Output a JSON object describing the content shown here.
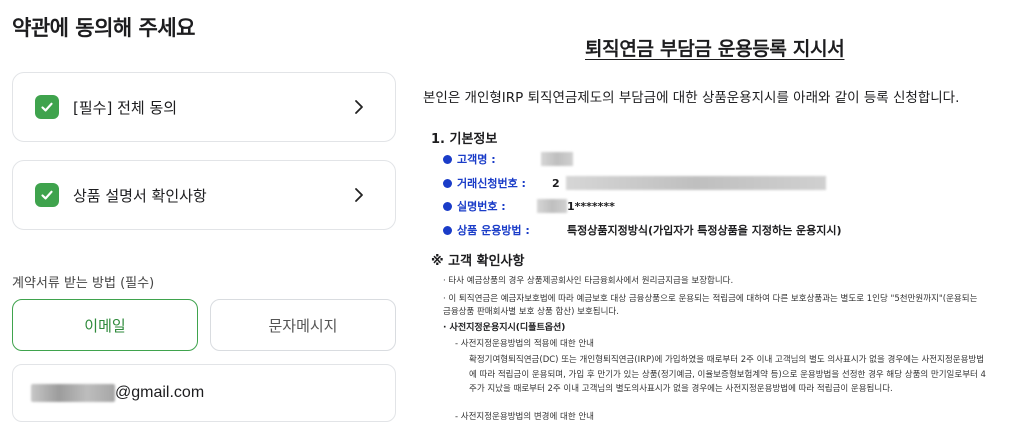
{
  "left": {
    "title": "약관에 동의해 주세요",
    "agree_all": "[필수] 전체 동의",
    "product_confirm": "상품 설명서 확인사항",
    "receive_label": "계약서류 받는 방법 (필수)",
    "email_button": "이메일",
    "sms_button": "문자메시지",
    "email_suffix": "@gmail.com",
    "accent_color": "#3fa34d"
  },
  "doc": {
    "title": "퇴직연금 부담금 운용등록 지시서",
    "intro": "본인은 개인형IRP 퇴직연금제도의 부담금에 대한 상품운용지시를 아래와 같이 등록 신청합니다.",
    "section1": "1. 기본정보",
    "fields": {
      "customer_name": "고객명 :",
      "account_no": "거래신청번호 :",
      "account_prefix": "2",
      "real_name_no": "실명번호 :",
      "real_name_value": "1*******",
      "method_label": "상품 운용방법 :",
      "method_value": "특정상품지정방식(가입자가 특정상품을 지정하는 운용지시)"
    },
    "section2": "※ 고객 확인사항",
    "notes": [
      "· 타사 예금상품의 경우 상품제공회사인 타금융회사에서 원리금지급을 보장합니다.",
      "· 이 퇴직연금은 예금자보호법에 따라 예금보호 대상 금융상품으로 운용되는 적립금에 대하여 다른 보호상품과는 별도로 1인당 \"5천만원까지\"(운용되는",
      "  금융상품 판매회사별 보호 상품 합산) 보호됩니다."
    ],
    "sub_title": "· 사전지정운용지시(디폴트옵션)",
    "sub_item": "- 사전지정운용방법의 적용에 대한 안내",
    "para": [
      "확정기여형퇴직연금(DC) 또는 개인형퇴직연금(IRP)에 가입하였을 때로부터 2주 이내 고객님의 별도 의사표시가 없을 경우에는 사전지정운용방법",
      "에 따라 적립금이 운용되며, 가입 후 만기가 있는 상품(정기예금, 이율보증형보험계약 등)으로 운용방법을 선정한 경우 해당 상품의 만기일로부터 4",
      "주가 지났을 때로부터 2주 이내 고객님의 별도의사표시가 없을 경우에는 사전지정운용방법에 따라 적립금이 운용됩니다."
    ],
    "sub_item2": "- 사전지정운용방법의 변경에 대한 안내"
  }
}
